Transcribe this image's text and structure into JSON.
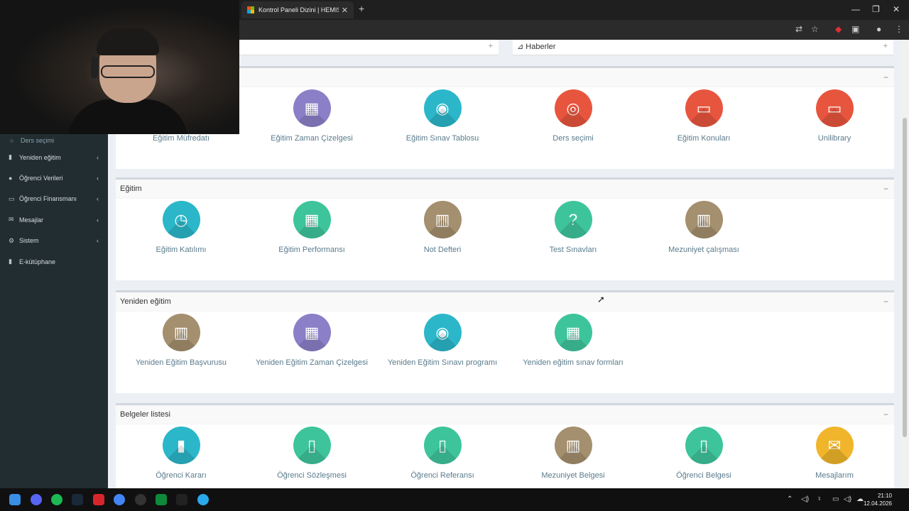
{
  "browser": {
    "tab_title": "Kontrol Paneli Dizini | HEMIS Ö",
    "tab_close": "✕",
    "new_tab": "+",
    "window_min": "—",
    "window_max": "❐",
    "window_close": "✕"
  },
  "top_boxes": {
    "news_title": "Haberler"
  },
  "sidebar": {
    "items": [
      {
        "label": "Ders seçimi",
        "icon": "circle-icon",
        "sub": true
      },
      {
        "label": "Yeniden eğitim",
        "icon": "book-icon",
        "caret": "‹"
      },
      {
        "label": "Öğrenci Verileri",
        "icon": "user-icon",
        "caret": "‹"
      },
      {
        "label": "Öğrenci Finansmanı",
        "icon": "money-icon",
        "caret": "‹"
      },
      {
        "label": "Mesajlar",
        "icon": "envelope-icon",
        "caret": "‹"
      },
      {
        "label": "Sistem",
        "icon": "gear-icon",
        "caret": "‹"
      },
      {
        "label": "E-kütüphane",
        "icon": "book-icon"
      }
    ]
  },
  "panels": [
    {
      "title": "",
      "tiles": [
        {
          "label": "Eğitim Müfredatı",
          "color": "#3d9ad6",
          "icon": "list-icon"
        },
        {
          "label": "Eğitim Zaman Çizelgesi",
          "color": "#8b7fc8",
          "icon": "calendar-icon"
        },
        {
          "label": "Eğitim Sınav Tablosu",
          "color": "#2bb7c9",
          "icon": "medal-icon"
        },
        {
          "label": "Ders seçimi",
          "color": "#e8553e",
          "icon": "target-icon"
        },
        {
          "label": "Eğitim Konuları",
          "color": "#e8553e",
          "icon": "presentation-icon"
        },
        {
          "label": "Unilibrary",
          "color": "#e8553e",
          "icon": "presentation-icon"
        }
      ]
    },
    {
      "title": "Eğitim",
      "tiles": [
        {
          "label": "Eğitim Katılımı",
          "color": "#2bb7c9",
          "icon": "clock-icon"
        },
        {
          "label": "Eğitim Performansı",
          "color": "#3ec49b",
          "icon": "calculator-icon"
        },
        {
          "label": "Not Defteri",
          "color": "#a48f6e",
          "icon": "open-book-icon"
        },
        {
          "label": "Test Sınavları",
          "color": "#3ec49b",
          "icon": "question-icon"
        },
        {
          "label": "Mezuniyet çalışması",
          "color": "#a48f6e",
          "icon": "open-book-icon"
        }
      ]
    },
    {
      "title": "Yeniden eğitim",
      "tiles": [
        {
          "label": "Yeniden Eğitim Başvurusu",
          "color": "#a48f6e",
          "icon": "open-book-icon"
        },
        {
          "label": "Yeniden Eğitim Zaman Çizelgesi",
          "color": "#8b7fc8",
          "icon": "calendar-icon"
        },
        {
          "label": "Yeniden Eğitim Sınavı programı",
          "color": "#2bb7c9",
          "icon": "medal-icon"
        },
        {
          "label": "Yeniden eğitim sınav formları",
          "color": "#3ec49b",
          "icon": "calculator-icon"
        }
      ]
    },
    {
      "title": "Belgeler listesi",
      "tiles": [
        {
          "label": "Öğrenci Kararı",
          "color": "#2bb7c9",
          "icon": "notebook-icon"
        },
        {
          "label": "Öğrenci Sözleşmesi",
          "color": "#3ec49b",
          "icon": "document-icon"
        },
        {
          "label": "Öğrenci Referansı",
          "color": "#3ec49b",
          "icon": "document-icon"
        },
        {
          "label": "Mezuniyet Belgesi",
          "color": "#a48f6e",
          "icon": "open-book-icon"
        },
        {
          "label": "Öğrenci Belgesi",
          "color": "#3ec49b",
          "icon": "document-icon"
        },
        {
          "label": "Mesajlarım",
          "color": "#f0b52b",
          "icon": "envelope-icon"
        }
      ]
    }
  ],
  "taskbar": {
    "time": "21:10",
    "date": "12.04.2026"
  }
}
